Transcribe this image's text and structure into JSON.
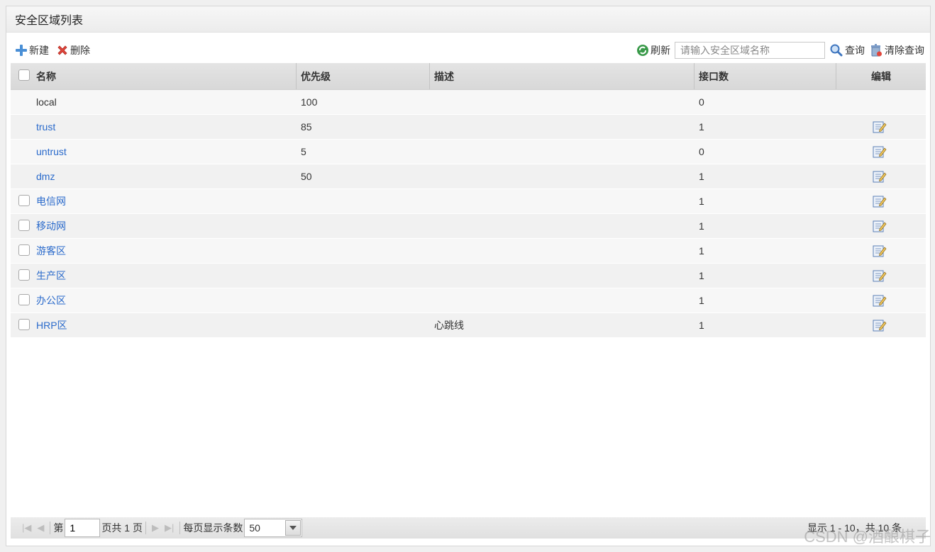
{
  "panel": {
    "title": "安全区域列表"
  },
  "toolbar": {
    "new_label": "新建",
    "delete_label": "删除",
    "refresh_label": "刷新",
    "search_placeholder": "请输入安全区域名称",
    "query_label": "查询",
    "clear_label": "清除查询"
  },
  "columns": {
    "name": "名称",
    "priority": "优先级",
    "desc": "描述",
    "ifcount": "接口数",
    "edit": "编辑"
  },
  "rows": [
    {
      "name": "local",
      "priority": "100",
      "desc": "",
      "ifcount": "0",
      "link": false,
      "checkbox": false,
      "edit": false
    },
    {
      "name": "trust",
      "priority": "85",
      "desc": "",
      "ifcount": "1",
      "link": true,
      "checkbox": false,
      "edit": true
    },
    {
      "name": "untrust",
      "priority": "5",
      "desc": "",
      "ifcount": "0",
      "link": true,
      "checkbox": false,
      "edit": true
    },
    {
      "name": "dmz",
      "priority": "50",
      "desc": "",
      "ifcount": "1",
      "link": true,
      "checkbox": false,
      "edit": true
    },
    {
      "name": "电信网",
      "priority": "",
      "desc": "",
      "ifcount": "1",
      "link": true,
      "checkbox": true,
      "edit": true
    },
    {
      "name": "移动网",
      "priority": "",
      "desc": "",
      "ifcount": "1",
      "link": true,
      "checkbox": true,
      "edit": true
    },
    {
      "name": "游客区",
      "priority": "",
      "desc": "",
      "ifcount": "1",
      "link": true,
      "checkbox": true,
      "edit": true
    },
    {
      "name": "生产区",
      "priority": "",
      "desc": "",
      "ifcount": "1",
      "link": true,
      "checkbox": true,
      "edit": true
    },
    {
      "name": "办公区",
      "priority": "",
      "desc": "",
      "ifcount": "1",
      "link": true,
      "checkbox": true,
      "edit": true
    },
    {
      "name": "HRP区",
      "priority": "",
      "desc": "心跳线",
      "ifcount": "1",
      "link": true,
      "checkbox": true,
      "edit": true
    }
  ],
  "pager": {
    "page_prefix": "第",
    "page_value": "1",
    "page_suffix": "页共 1 页",
    "per_page_label": "每页显示条数",
    "per_page_value": "50",
    "info": "显示 1 - 10，共 10 条"
  },
  "watermark": "CSDN @酒酿棋子",
  "colors": {
    "link": "#2a6acb",
    "header_bg": "#dcdcdc",
    "row_alt": "#f7f7f7"
  },
  "icons": {
    "new": "plus-icon",
    "delete": "red-x-icon",
    "refresh": "refresh-icon",
    "query": "magnifier-icon",
    "clear": "trash-icon",
    "edit": "edit-note-icon",
    "pager": [
      "first-page-icon",
      "prev-page-icon",
      "next-page-icon",
      "last-page-icon"
    ]
  }
}
